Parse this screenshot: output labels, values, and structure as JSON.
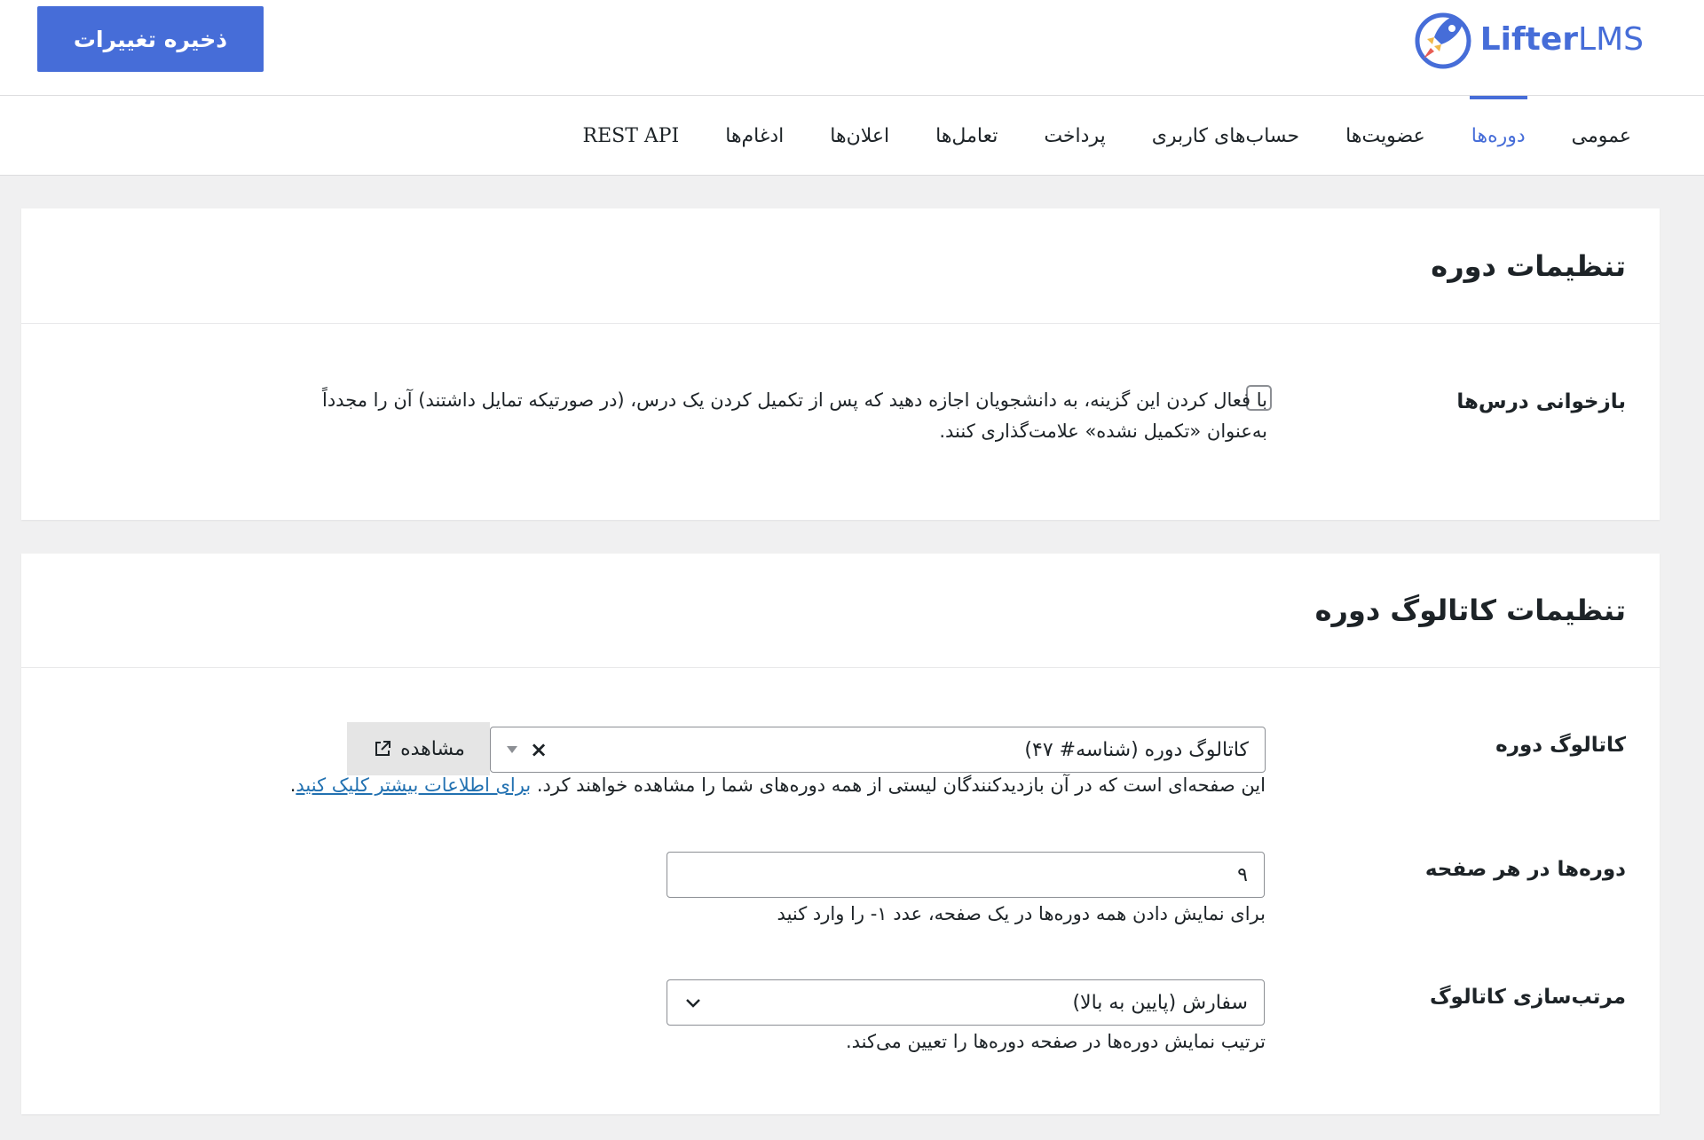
{
  "header": {
    "save_label": "ذخیره تغییرات",
    "logo_bold": "Lifter",
    "logo_light": "LMS",
    "brand_color": "#466dd8"
  },
  "tabs": [
    {
      "label": "عمومی",
      "active": false
    },
    {
      "label": "دوره‌ها",
      "active": true
    },
    {
      "label": "عضویت‌ها",
      "active": false
    },
    {
      "label": "حساب‌های کاربری",
      "active": false
    },
    {
      "label": "پرداخت",
      "active": false
    },
    {
      "label": "تعامل‌ها",
      "active": false
    },
    {
      "label": "اعلان‌ها",
      "active": false
    },
    {
      "label": "ادغام‌ها",
      "active": false
    },
    {
      "label": "REST API",
      "active": false
    }
  ],
  "course_settings": {
    "title": "تنظیمات دوره",
    "retake": {
      "label": "بازخوانی درس‌ها",
      "checked": false,
      "desc_line1": "با فعال کردن این گزینه، به دانشجویان اجازه دهید که پس از تکمیل کردن یک درس، (در صورتیکه تمایل داشتند) آن را مجدداً",
      "desc_line2": "به‌عنوان «تکمیل نشده» علامت‌گذاری کنند."
    }
  },
  "catalog_settings": {
    "title": "تنظیمات کاتالوگ دوره",
    "catalog": {
      "label": "کاتالوگ دوره",
      "value": "کاتالوگ دوره (شناسه# ۴۷)",
      "clear_symbol": "×",
      "view_label": "مشاهده",
      "desc": "این صفحه‌ای است که در آن بازدیدکنندگان لیستی از همه دوره‌های شما را مشاهده خواهند کرد.",
      "link_text": "برای اطلاعات بیشتر کلیک کنید",
      "link_suffix": "."
    },
    "per_page": {
      "label": "دوره‌ها در هر صفحه",
      "value": "۹",
      "desc": "برای نمایش دادن همه دوره‌ها در یک صفحه، عدد ۱- را وارد کنید"
    },
    "sorting": {
      "label": "مرتب‌سازی کاتالوگ",
      "value": "سفارش (پایین به بالا)",
      "desc": "ترتیب نمایش دوره‌ها در صفحه دوره‌ها را تعیین می‌کند."
    }
  }
}
